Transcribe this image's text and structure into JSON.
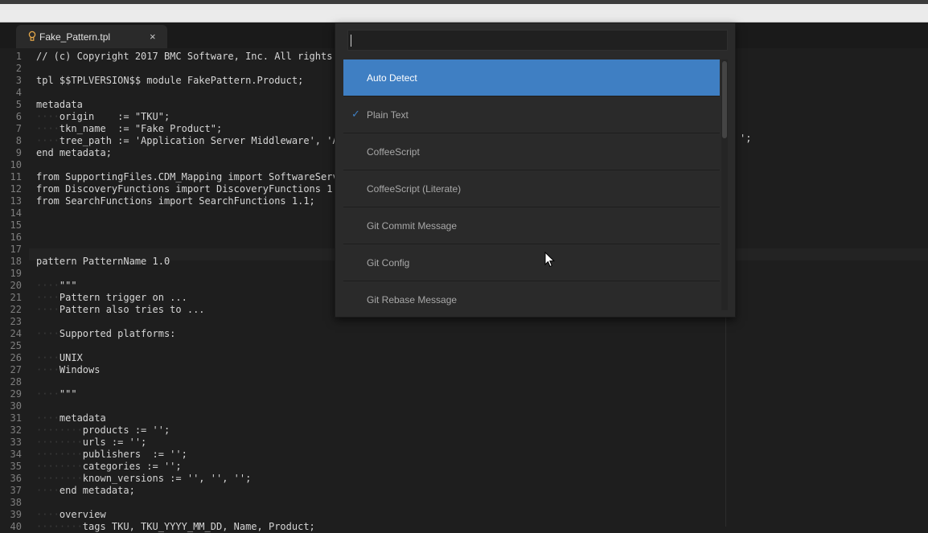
{
  "tab": {
    "filename": "Fake_Pattern.tpl",
    "close_icon": "×"
  },
  "gutter": {
    "numbers": [
      "1",
      "2",
      "3",
      "4",
      "5",
      "6",
      "7",
      "8",
      "9",
      "10",
      "11",
      "12",
      "13",
      "14",
      "15",
      "16",
      "17",
      "18",
      "19",
      "20",
      "21",
      "22",
      "23",
      "24",
      "25",
      "26",
      "27",
      "28",
      "29",
      "30",
      "31",
      "32",
      "33",
      "34",
      "35",
      "36",
      "37",
      "38",
      "39",
      "40"
    ]
  },
  "code": {
    "lines": [
      "// (c) Copyright 2017 BMC Software, Inc. All rights",
      "",
      "tpl $$TPLVERSION$$ module FakePattern.Product;",
      "",
      "metadata",
      "····origin    := \"TKU\";",
      "····tkn_name  := \"Fake Product\";",
      "····tree_path := 'Application Server Middleware', 'A",
      "end metadata;",
      "",
      "from SupportingFiles.CDM_Mapping import SoftwareServ",
      "from DiscoveryFunctions import DiscoveryFunctions 1.",
      "from SearchFunctions import SearchFunctions 1.1;",
      "",
      "",
      "",
      "",
      "pattern PatternName 1.0",
      "",
      "····\"\"\"",
      "····Pattern trigger on ...",
      "····Pattern also tries to ...",
      "",
      "····Supported platforms:",
      "",
      "····UNIX",
      "····Windows",
      "",
      "····\"\"\"",
      "",
      "····metadata",
      "········products := '';",
      "········urls := '';",
      "········publishers  := '';",
      "········categories := '';",
      "········known_versions := '', '', '';",
      "····end metadata;",
      "",
      "····overview",
      "········tags TKU, TKU_YYYY_MM_DD, Name, Product;"
    ],
    "overflow_tail_line8": "';"
  },
  "syntax_picker": {
    "search_value": "",
    "items": [
      {
        "label": "Auto Detect",
        "selected": true,
        "checked": false
      },
      {
        "label": "Plain Text",
        "selected": false,
        "checked": true
      },
      {
        "label": "CoffeeScript",
        "selected": false,
        "checked": false
      },
      {
        "label": "CoffeeScript (Literate)",
        "selected": false,
        "checked": false
      },
      {
        "label": "Git Commit Message",
        "selected": false,
        "checked": false
      },
      {
        "label": "Git Config",
        "selected": false,
        "checked": false
      },
      {
        "label": "Git Rebase Message",
        "selected": false,
        "checked": false
      }
    ],
    "check_glyph": "✓"
  },
  "colors": {
    "accent": "#3f7fc3",
    "editor_bg": "#1e1e1e",
    "text": "#d6d6d6"
  }
}
